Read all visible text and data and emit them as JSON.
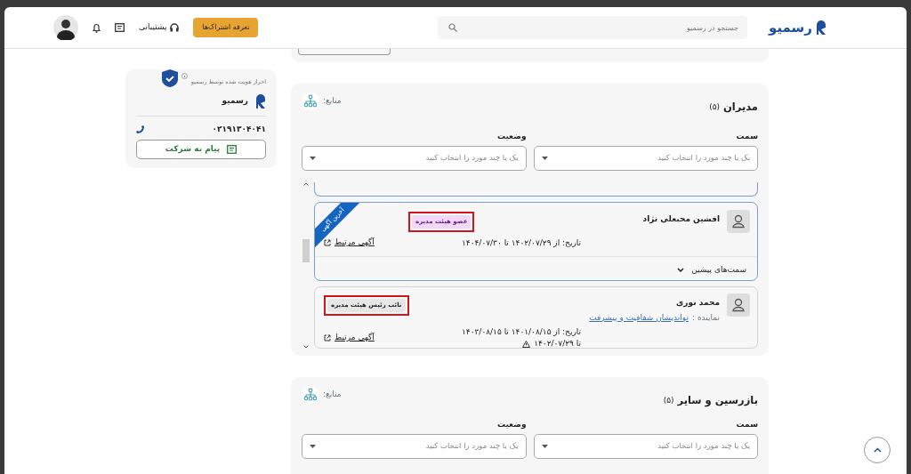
{
  "header": {
    "logo": "رسمیو",
    "search": {
      "placeholder": "جستجو در رسمیو"
    },
    "subscription_button": "تعرفه اشتراک‌ها",
    "support": "پشتیبانی"
  },
  "company_card": {
    "verified_note": "احراز هویت شده توسط رسمیو",
    "name": "رسمیو",
    "phone": "۰۲۱۹۱۳۰۴۰۴۱",
    "message_button": "پیام به شرکت"
  },
  "sections": [
    {
      "title": "مدیران",
      "count": "(۵)",
      "source": "منابع:",
      "filters": [
        {
          "label": "سمت",
          "placeholder": "یک یا چند مورد را انتخاب کنید"
        },
        {
          "label": "وضعیت",
          "placeholder": "یک یا چند مورد را انتخاب کنید"
        }
      ],
      "people": [
        {
          "name": "افشین محبعلی نژاد",
          "role": "عضو هیئت مدیره",
          "color": "#f0d9f7",
          "highlighted": true,
          "ribbon": "آخرین آگهی",
          "selected": true,
          "dates": [
            "تاریخ: از ۱۴۰۲/۰۷/۲۹ تا ۱۴۰۴/۰۷/۳۰"
          ],
          "link": "آگهی مرتبط",
          "history_toggle": "سمت‌های پیشین"
        },
        {
          "name": "محمد نوری",
          "role": "نائب رئیس هیئت مدیره",
          "color": "#e6e6e6",
          "highlighted": true,
          "selected": false,
          "representative_label": "نماینده :",
          "representative": "نواندیشان شفافیت و پیشرفت",
          "dates": [
            "تاریخ: از ۱۴۰۱/۰۸/۱۵ تا ۱۴۰۳/۰۸/۱۵"
          ],
          "warning_date": "تا ۱۴۰۲/۰۷/۲۹",
          "link": "آگهی مرتبط"
        }
      ]
    },
    {
      "title": "بازرسین و سایر",
      "count": "(۵)",
      "source": "منابع:",
      "filters": [
        {
          "label": "سمت",
          "placeholder": "یک یا چند مورد را انتخاب کنید"
        },
        {
          "label": "وضعیت",
          "placeholder": "یک یا چند مورد را انتخاب کنید"
        }
      ]
    }
  ]
}
